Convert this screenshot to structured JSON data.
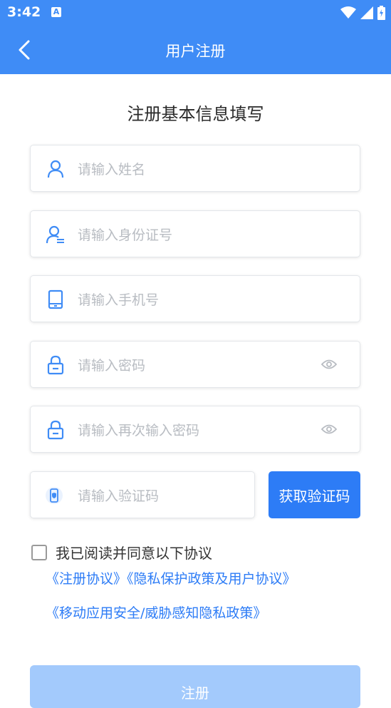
{
  "status_bar": {
    "time": "3:42",
    "notification_icon": "A"
  },
  "app_bar": {
    "title": "用户注册"
  },
  "heading": "注册基本信息填写",
  "fields": {
    "name": {
      "placeholder": "请输入姓名"
    },
    "id_card": {
      "placeholder": "请输入身份证号"
    },
    "phone": {
      "placeholder": "请输入手机号"
    },
    "password": {
      "placeholder": "请输入密码"
    },
    "password_confirm": {
      "placeholder": "请输入再次输入密码"
    },
    "code": {
      "placeholder": "请输入验证码"
    }
  },
  "get_code_button": "获取验证码",
  "agreement": {
    "label": "我已阅读并同意以下协议",
    "checked": false,
    "link_register": "《注册协议》",
    "link_privacy": "《隐私保护政策及用户协议》",
    "link_security": "《移动应用安全/威胁感知隐私政策》"
  },
  "submit_button": "注册",
  "colors": {
    "primary": "#3f8cf6",
    "button": "#2d7cf6",
    "submit_disabled": "#a3cafc"
  }
}
